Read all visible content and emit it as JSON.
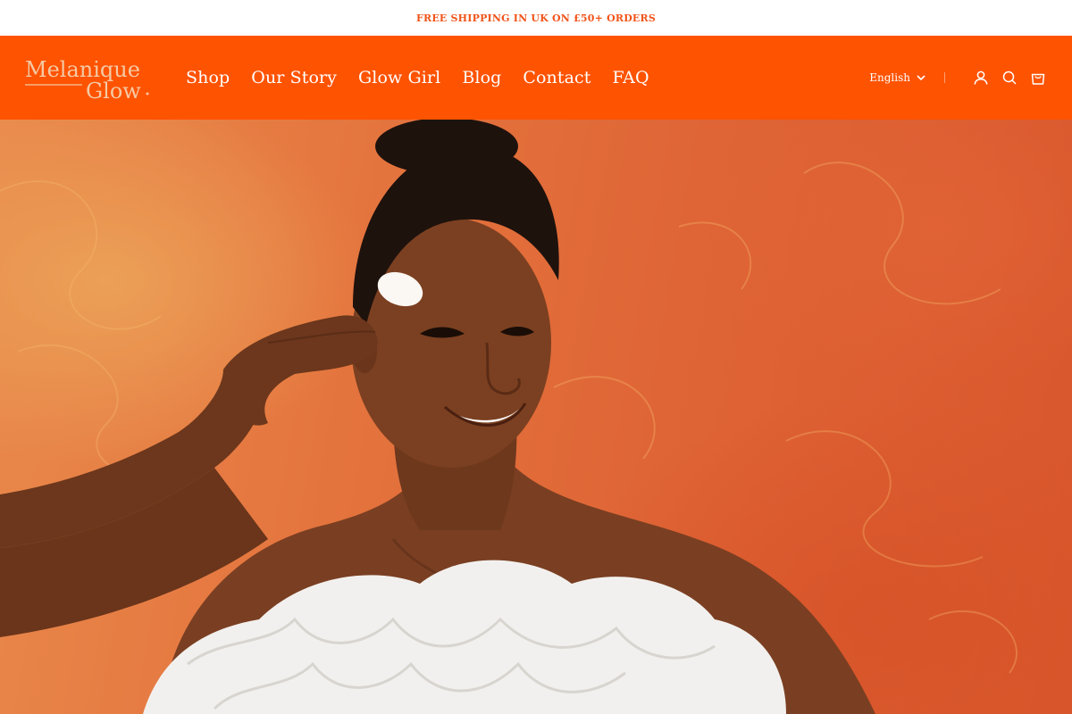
{
  "announcement": {
    "text": "FREE SHIPPING IN UK ON £50+ ORDERS"
  },
  "brand": {
    "logo_line1": "Melanique",
    "logo_line2": "Glow"
  },
  "nav": {
    "items": [
      {
        "label": "Shop"
      },
      {
        "label": "Our Story"
      },
      {
        "label": "Glow Girl"
      },
      {
        "label": "Blog"
      },
      {
        "label": "Contact"
      },
      {
        "label": "FAQ"
      }
    ]
  },
  "header_tools": {
    "language": "English",
    "icons": [
      "account-icon",
      "search-icon",
      "cart-icon"
    ]
  },
  "hero": {
    "image": "model applying cream to cheek on orange marbled background"
  },
  "colors": {
    "header_bg": "#fe5300",
    "announcement_text": "#f0541a",
    "logo_tint": "#f5c9a5",
    "hero_bg": "#e4733d"
  }
}
